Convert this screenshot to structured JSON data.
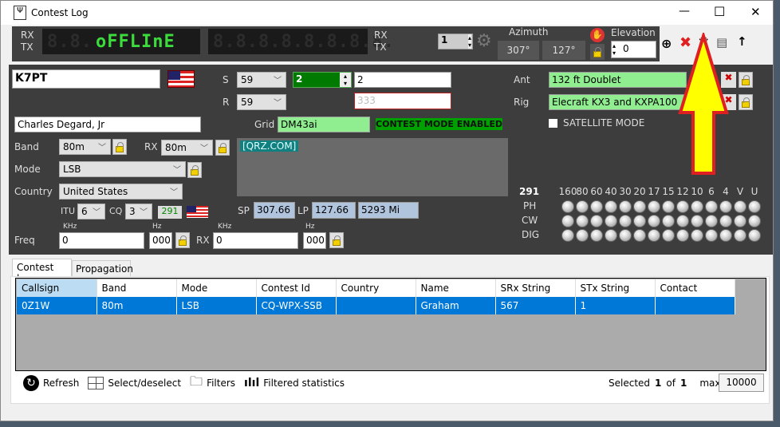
{
  "window": {
    "title": "Contest Log",
    "minimize": "—",
    "maximize": "☐",
    "close": "✕"
  },
  "radio": {
    "rx_label": "RX",
    "tx_label": "TX",
    "display_text": "oFFLInE",
    "vfo_spinner": "1",
    "azimuth_label": "Azimuth",
    "azimuth_sp": "307°",
    "azimuth_lp": "127°",
    "elevation_label": "Elevation",
    "elevation_value": "0"
  },
  "qso": {
    "callsign": "K7PT",
    "name": "Charles Degard, Jr",
    "s_label": "S",
    "r_label": "R",
    "rst_sent": "59",
    "rst_rcvd": "59",
    "serial_spinner": "2",
    "stx": "2",
    "srx_placeholder": "333",
    "grid_label": "Grid",
    "grid": "DM43ai",
    "contest_mode": "CONTEST MODE ENABLED",
    "band_label": "Band",
    "band": "80m",
    "rx_label": "RX",
    "rx_band": "80m",
    "mode_label": "Mode",
    "mode": "LSB",
    "country_label": "Country",
    "country": "United States",
    "itu_label": "ITU",
    "itu": "6",
    "cq_label": "CQ",
    "cq": "3",
    "dxcc": "291",
    "qrz_link": "[QRZ.COM]",
    "sp_label": "SP",
    "sp": "307.66",
    "lp_label": "LP",
    "lp": "127.66",
    "distance": "5293 Mi",
    "khz_label": "KHz",
    "hz_label": "Hz",
    "freq_label": "Freq",
    "freq_khz": "0",
    "freq_hz": "000",
    "rx_freq_khz": "0",
    "rx_freq_hz": "000"
  },
  "station": {
    "ant_label": "Ant",
    "ant": "132 ft Doublet",
    "rig_label": "Rig",
    "rig": "Elecraft KX3 and KXPA100",
    "satellite_label": "SATELLITE MODE"
  },
  "bands": {
    "dxcc": "291",
    "columns": [
      "160",
      "80",
      "60",
      "40",
      "30",
      "20",
      "17",
      "15",
      "12",
      "10",
      "6",
      "4",
      "V",
      "U"
    ],
    "rows": [
      "PH",
      "CW",
      "DIG"
    ]
  },
  "tabs": [
    {
      "label": "Contest log",
      "active": true
    },
    {
      "label": "Propagation",
      "active": false
    }
  ],
  "table": {
    "headers": [
      "Callsign",
      "Band",
      "Mode",
      "Contest Id",
      "Country",
      "Name",
      "SRx String",
      "STx String",
      "Contact"
    ],
    "rows": [
      [
        "0Z1W",
        "80m",
        "LSB",
        "CQ-WPX-SSB",
        "",
        "Graham",
        "567",
        "1",
        ""
      ]
    ]
  },
  "footer": {
    "refresh": "Refresh",
    "select": "Select/deselect",
    "filters": "Filters",
    "stats": "Filtered statistics",
    "selected_label": "Selected",
    "selected": "1",
    "of_label": "of",
    "total": "1",
    "max_label": "max:",
    "max": "10000"
  },
  "colors": {
    "accent_green": "#00a000",
    "grid_bg": "#90ee90",
    "selection": "#0078d7",
    "arrow": "#ffff00"
  }
}
